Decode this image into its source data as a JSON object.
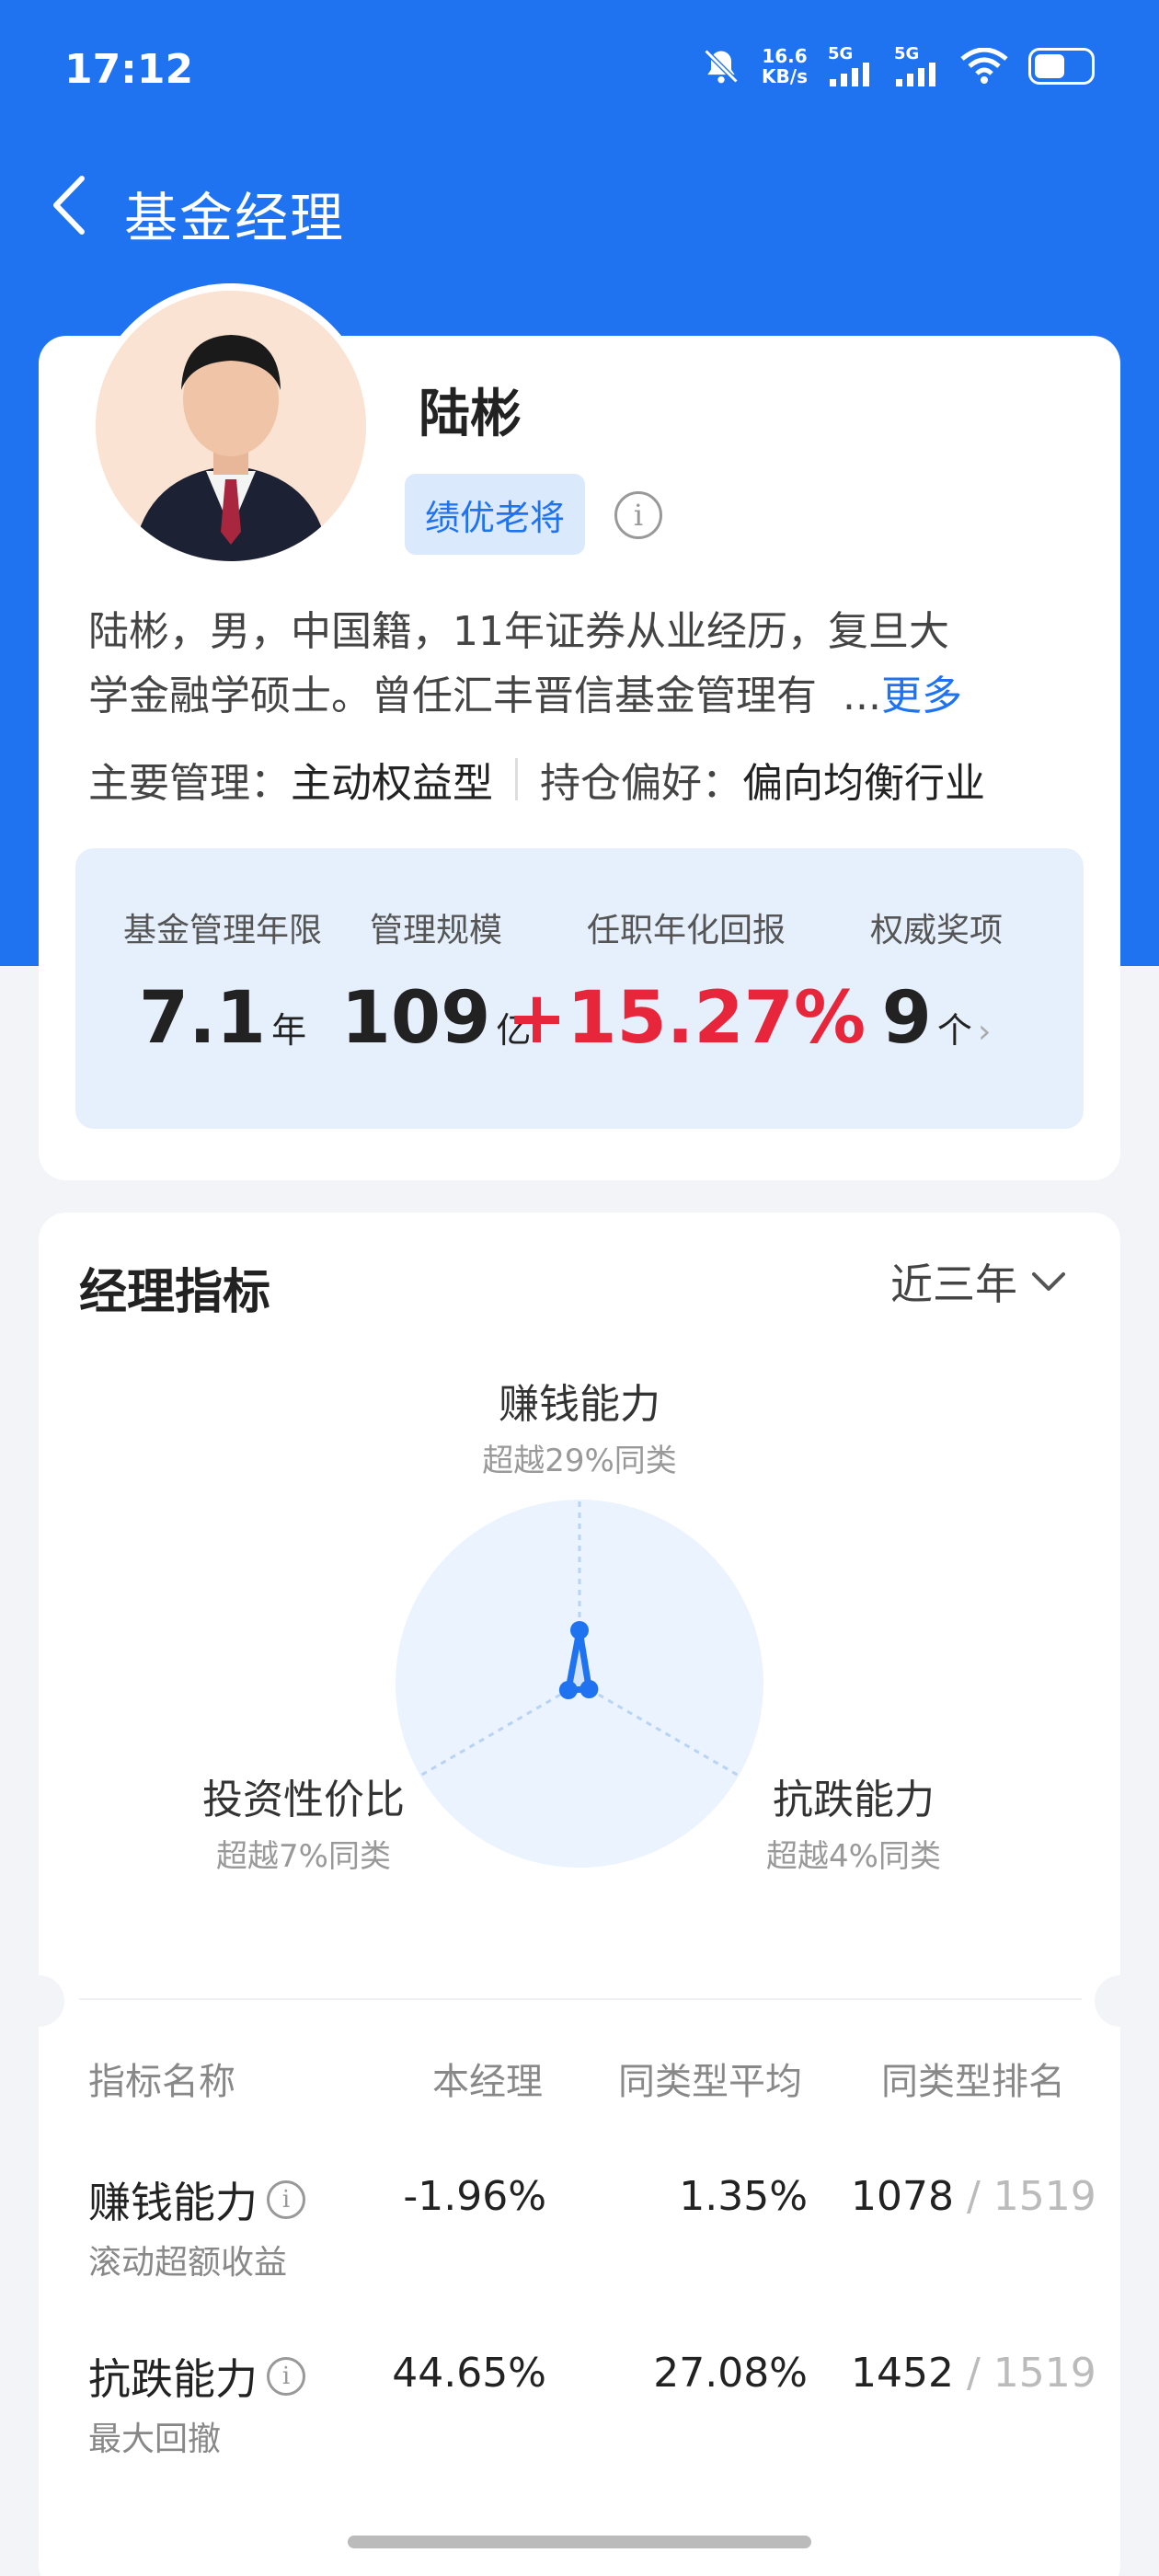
{
  "status_bar": {
    "time": "17:12",
    "net_speed_value": "16.6",
    "net_speed_unit": "KB/s",
    "signal1_label": "5G",
    "signal2_label": "5G",
    "icons": [
      "mute-bell-icon",
      "signal-icon",
      "signal-icon",
      "wifi-icon",
      "battery-icon"
    ]
  },
  "nav": {
    "back_icon": "chevron-left-icon",
    "title": "基金经理"
  },
  "profile": {
    "name": "陆彬",
    "badge": "绩优老将",
    "info_glyph": "i",
    "bio_line1": "陆彬，男，中国籍，11年证券从业经历，复旦大",
    "bio_line2": "学金融学硕士。曾任汇丰晋信基金管理有",
    "ellipsis": "...",
    "more": "更多",
    "main_mgmt_label": "主要管理：",
    "main_mgmt_value": "主动权益型",
    "holding_pref_label": "持仓偏好：",
    "holding_pref_value": "偏向均衡行业"
  },
  "stats": [
    {
      "label": "基金管理年限",
      "value": "7.1",
      "unit": "年"
    },
    {
      "label": "管理规模",
      "value": "109",
      "unit": "亿"
    },
    {
      "label": "任职年化回报",
      "value": "+15.27%",
      "unit": ""
    },
    {
      "label": "权威奖项",
      "value": "9",
      "unit": "个"
    }
  ],
  "metrics": {
    "title": "经理指标",
    "period": "近三年",
    "radar": {
      "axes": [
        {
          "name": "赚钱能力",
          "beat": "超越29%同类",
          "percentile": 0.29
        },
        {
          "name": "抗跌能力",
          "beat": "超越4%同类",
          "percentile": 0.04
        },
        {
          "name": "投资性价比",
          "beat": "超越7%同类",
          "percentile": 0.07
        }
      ],
      "colors": {
        "fill": "#eaf3fe",
        "line": "#1f73f1",
        "axis": "#b9d3f3"
      }
    },
    "table": {
      "headers": [
        "指标名称",
        "本经理",
        "同类型平均",
        "同类型排名"
      ],
      "rows": [
        {
          "name": "赚钱能力",
          "sub": "滚动超额收益",
          "value": "-1.96%",
          "avg": "1.35%",
          "rank": "1078",
          "total": "/ 1519"
        },
        {
          "name": "抗跌能力",
          "sub": "最大回撤",
          "value": "44.65%",
          "avg": "27.08%",
          "rank": "1452",
          "total": "/ 1519"
        }
      ]
    }
  },
  "colors": {
    "brand": "#1f73f1",
    "positive": "#e8263b",
    "stats_bg": "#e6f0fd"
  }
}
